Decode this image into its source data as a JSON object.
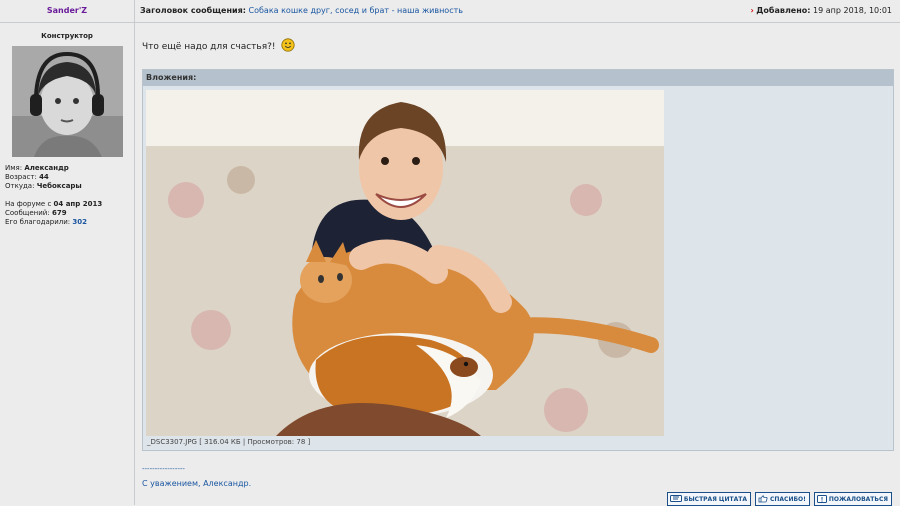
{
  "post": {
    "author": "Sander'Z",
    "subject_label": "Заголовок сообщения:",
    "subject_value": "Собака кошке друг, сосед и брат - наша живность",
    "added_label": "Добавлено:",
    "added_value": "19 апр 2018, 10:01",
    "message": "Что ещё надо для счастья?!"
  },
  "profile": {
    "rank": "Конструктор",
    "name_label": "Имя:",
    "name": "Александр",
    "age_label": "Возраст:",
    "age": "44",
    "from_label": "Откуда:",
    "from": "Чебоксары",
    "since_label": "На форуме с",
    "since": "04 апр 2013",
    "posts_label": "Сообщений:",
    "posts": "679",
    "thanks_label": "Его благодарили:",
    "thanks": "302"
  },
  "attachments": {
    "title": "Вложения:",
    "caption": "_DSC3307.JPG [ 316.04 КБ | Просмотров: 78 ]"
  },
  "signature": {
    "line": "-----------------",
    "text": "С уважением, Александр."
  },
  "buttons": {
    "quick_quote": "БЫСТРАЯ ЦИТАТА",
    "thanks": "СПАСИБО!",
    "report": "ПОЖАЛОВАТЬСЯ"
  },
  "colors": {
    "link": "#1a56a0",
    "author": "#6a1b9a",
    "attach_header": "#b5c2cd"
  }
}
